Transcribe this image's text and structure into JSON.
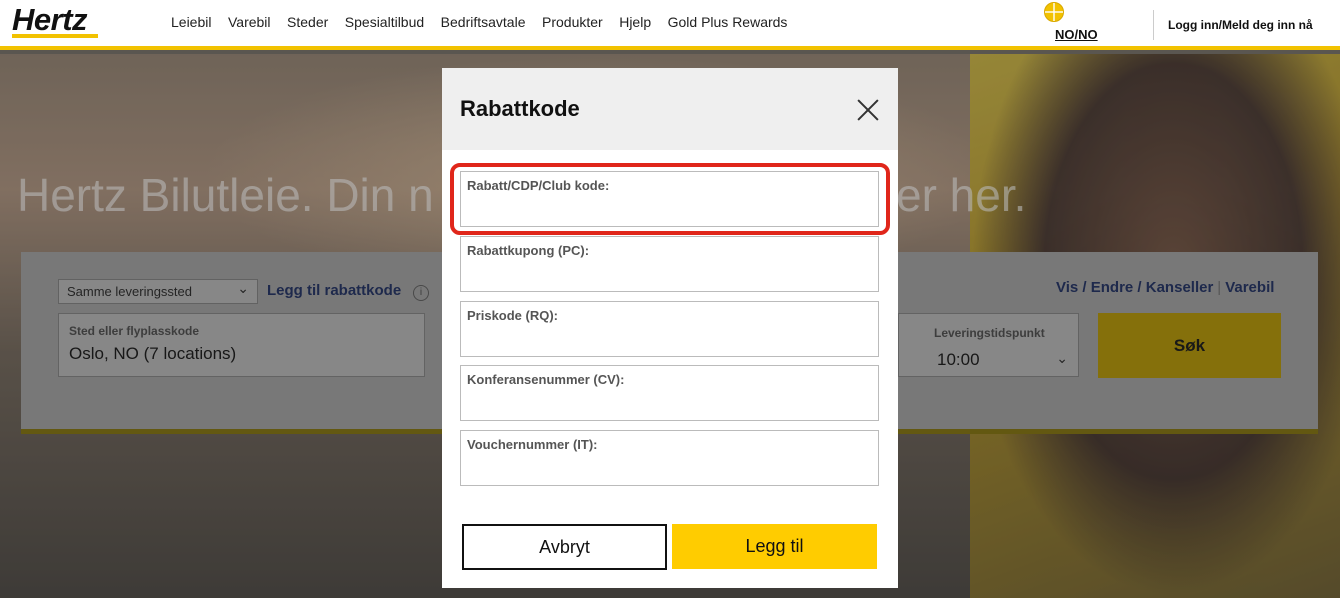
{
  "header": {
    "logo": "Hertz",
    "nav": [
      "Leiebil",
      "Varebil",
      "Steder",
      "Spesialtilbud",
      "Bedriftsavtale",
      "Produkter",
      "Hjelp",
      "Gold Plus Rewards"
    ],
    "language": "NO/NO",
    "login": "Logg inn/Meld deg inn nå"
  },
  "hero": {
    "title_left": "Hertz Bilutleie. Din n",
    "title_right": "er her."
  },
  "booking": {
    "location_select": "Samme leveringssted",
    "add_discount_link": "Legg til rabattkode",
    "info": "i",
    "pickup_label": "Sted eller flyplasskode",
    "pickup_value": "Oslo, NO (7 locations)",
    "links": [
      "Vis / Endre / Kanseller",
      "Varebil"
    ],
    "time_label": "Leveringstidspunkt",
    "time_value": "10:00",
    "search_button": "Søk"
  },
  "modal": {
    "title": "Rabattkode",
    "fields": [
      {
        "label": "Rabatt/CDP/Club kode:",
        "value": ""
      },
      {
        "label": "Rabattkupong (PC):",
        "value": ""
      },
      {
        "label": "Priskode (RQ):",
        "value": ""
      },
      {
        "label": "Konferansenummer (CV):",
        "value": ""
      },
      {
        "label": "Vouchernummer (IT):",
        "value": ""
      }
    ],
    "cancel_button": "Avbryt",
    "add_button": "Legg til"
  },
  "colors": {
    "brand_yellow": "#ffcc00",
    "highlight_red": "#e0261a",
    "link_blue": "#2a3a6a"
  }
}
